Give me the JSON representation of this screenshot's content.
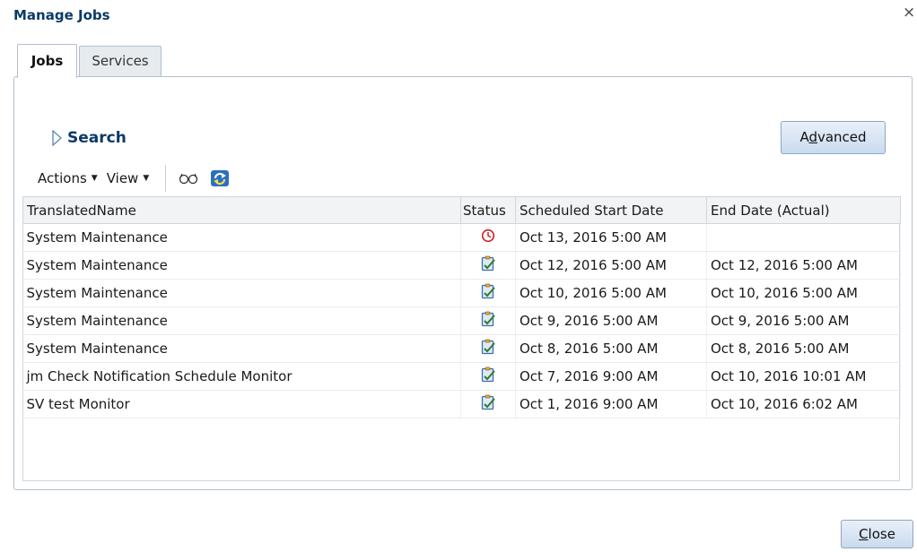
{
  "dialog": {
    "title": "Manage Jobs",
    "close_glyph": "×"
  },
  "tabs": [
    {
      "label": "Jobs",
      "selected": true
    },
    {
      "label": "Services",
      "selected": false
    }
  ],
  "search": {
    "label": "Search",
    "icon": "disclosure-triangle-icon",
    "expanded": false
  },
  "advanced_button": {
    "label_prefix": "A",
    "label_mnemonic": "d",
    "label_suffix": "vanced"
  },
  "toolbar": {
    "actions_label": "Actions",
    "view_label": "View",
    "icons": [
      "detach-glasses-icon",
      "refresh-icon"
    ]
  },
  "table": {
    "columns": [
      "TranslatedName",
      "Status",
      "Scheduled Start Date",
      "End Date (Actual)"
    ],
    "rows": [
      {
        "name": "System Maintenance",
        "status": "scheduled",
        "start": "Oct 13, 2016 5:00 AM",
        "end": ""
      },
      {
        "name": "System Maintenance",
        "status": "completed",
        "start": "Oct 12, 2016 5:00 AM",
        "end": "Oct 12, 2016 5:00 AM"
      },
      {
        "name": "System Maintenance",
        "status": "completed",
        "start": "Oct 10, 2016 5:00 AM",
        "end": "Oct 10, 2016 5:00 AM"
      },
      {
        "name": "System Maintenance",
        "status": "completed",
        "start": "Oct 9, 2016 5:00 AM",
        "end": "Oct 9, 2016 5:00 AM"
      },
      {
        "name": "System Maintenance",
        "status": "completed",
        "start": "Oct 8, 2016 5:00 AM",
        "end": "Oct 8, 2016 5:00 AM"
      },
      {
        "name": "jm Check Notification Schedule Monitor",
        "status": "completed",
        "start": "Oct 7, 2016 9:00 AM",
        "end": "Oct 10, 2016 10:01 AM"
      },
      {
        "name": "SV test Monitor",
        "status": "completed",
        "start": "Oct 1, 2016 9:00 AM",
        "end": "Oct 10, 2016 6:02 AM"
      }
    ]
  },
  "close_button": {
    "label_mnemonic": "C",
    "label_suffix": "lose"
  },
  "colors": {
    "title": "#0b3a66",
    "button_border": "#8fa6c0",
    "scheduled_icon": "#cc2222",
    "completed_icon": "#3a6fb0"
  }
}
